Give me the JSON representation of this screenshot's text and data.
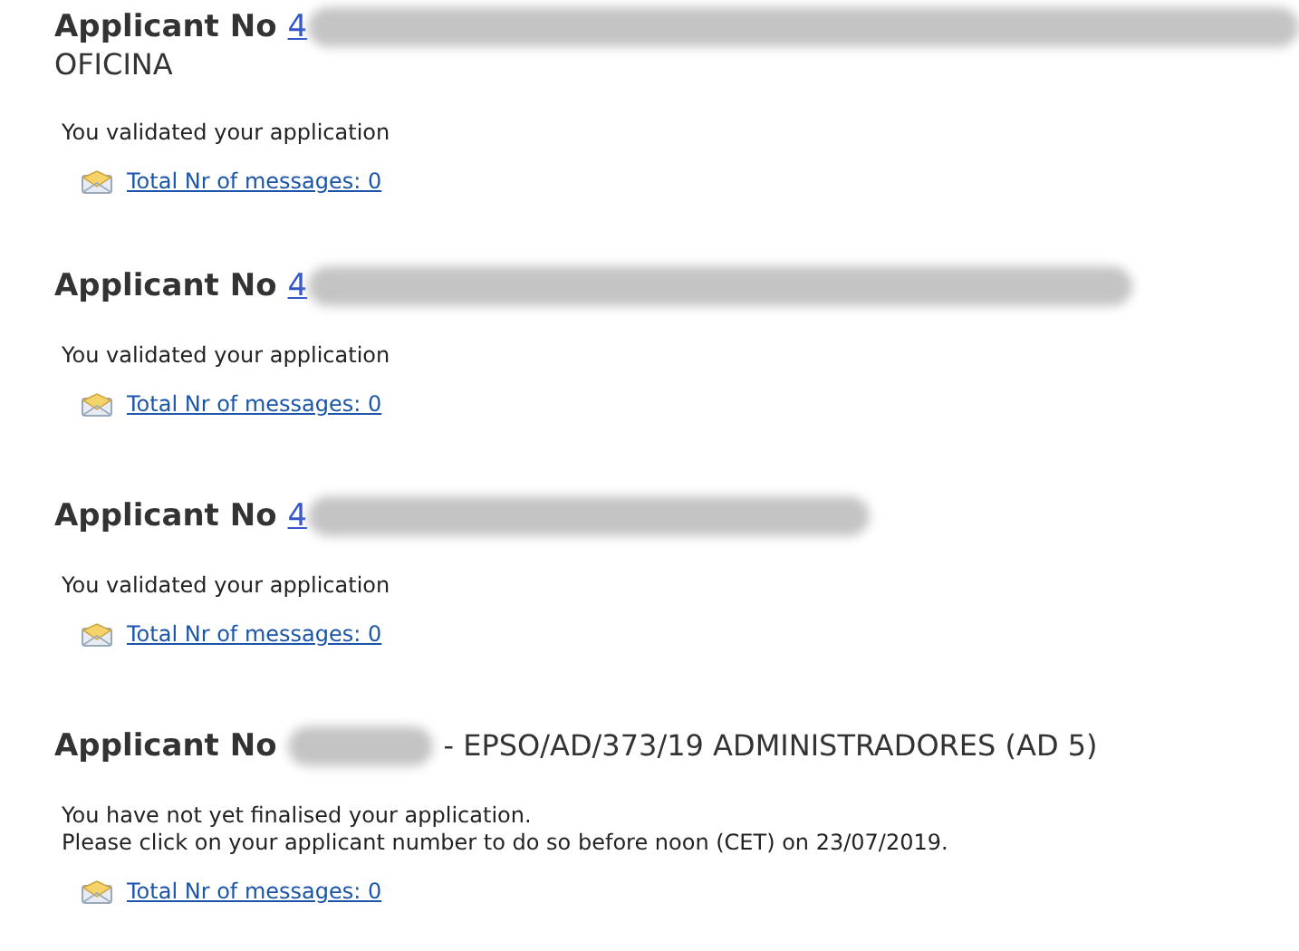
{
  "applications": [
    {
      "label": "Applicant No",
      "number": "4",
      "second_line": "OFICINA",
      "status": [
        "You validated your application"
      ],
      "messages_link": "Total Nr of messages: 0"
    },
    {
      "label": "Applicant No",
      "number": "4",
      "status": [
        "You validated your application"
      ],
      "messages_link": "Total Nr of messages: 0"
    },
    {
      "label": "Applicant No",
      "number": "4",
      "status": [
        "You validated your application"
      ],
      "messages_link": "Total Nr of messages: 0"
    },
    {
      "label": "Applicant No",
      "suffix": "- EPSO/AD/373/19 ADMINISTRADORES (AD 5)",
      "status": [
        "You have not yet finalised your application.",
        "Please click on your applicant number to do so before noon (CET) on 23/07/2019."
      ],
      "messages_link": "Total Nr of messages: 0"
    }
  ]
}
